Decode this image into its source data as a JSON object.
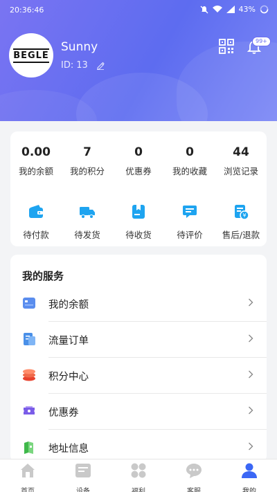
{
  "status_bar": {
    "time": "20:36:46",
    "battery": "43%"
  },
  "profile": {
    "avatar_text": "BEGLE",
    "username": "Sunny",
    "id_label": "ID:",
    "id_value": "13",
    "notification_badge": "99+"
  },
  "stats": [
    {
      "value": "0.00",
      "label": "我的余额"
    },
    {
      "value": "7",
      "label": "我的积分"
    },
    {
      "value": "0",
      "label": "优惠券"
    },
    {
      "value": "0",
      "label": "我的收藏"
    },
    {
      "value": "44",
      "label": "浏览记录"
    }
  ],
  "orders": [
    {
      "label": "待付款",
      "icon": "wallet-icon"
    },
    {
      "label": "待发货",
      "icon": "truck-icon"
    },
    {
      "label": "待收货",
      "icon": "package-icon"
    },
    {
      "label": "待评价",
      "icon": "comment-icon"
    },
    {
      "label": "售后/退款",
      "icon": "refund-icon"
    }
  ],
  "services": {
    "title": "我的服务",
    "items": [
      {
        "label": "我的余额",
        "icon": "balance-card-icon"
      },
      {
        "label": "流量订单",
        "icon": "traffic-order-icon"
      },
      {
        "label": "积分中心",
        "icon": "points-coins-icon"
      },
      {
        "label": "优惠券",
        "icon": "coupon-ticket-icon"
      },
      {
        "label": "地址信息",
        "icon": "address-map-icon"
      }
    ]
  },
  "tabs": [
    {
      "label": "首页",
      "icon": "home-icon"
    },
    {
      "label": "设备",
      "icon": "device-icon"
    },
    {
      "label": "福利",
      "icon": "welfare-grid-icon"
    },
    {
      "label": "客服",
      "icon": "chat-support-icon"
    },
    {
      "label": "我的",
      "icon": "profile-person-icon",
      "active": true
    }
  ],
  "colors": {
    "accent": "#5b6cf0",
    "icon_blue": "#1ea4f0",
    "active_tab": "#3b67f5"
  }
}
